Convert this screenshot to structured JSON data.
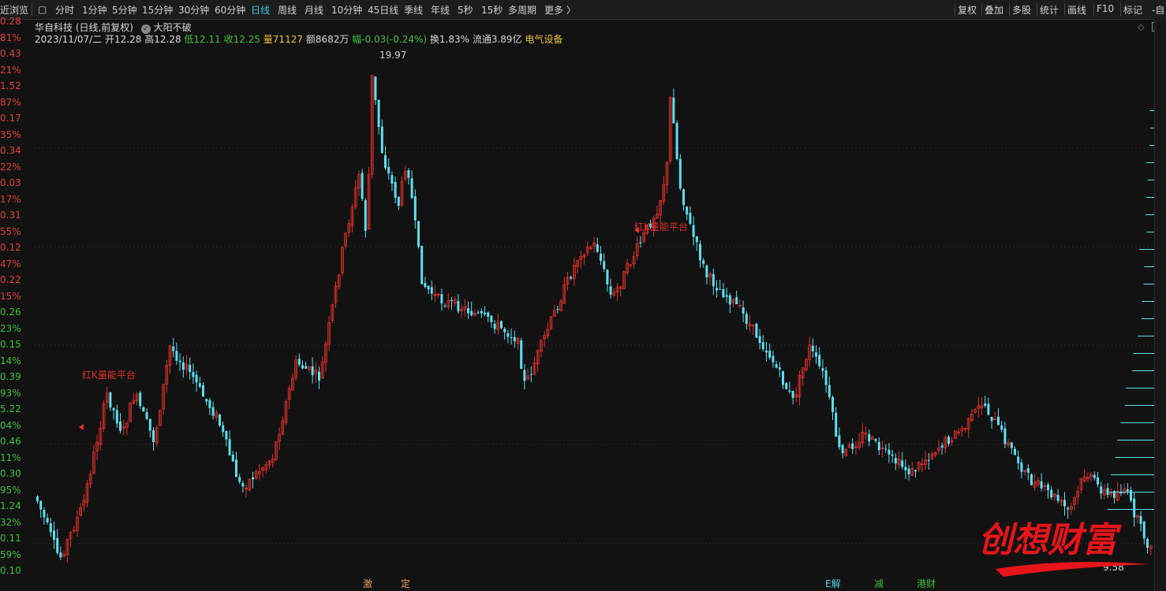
{
  "toolbar": {
    "left_label": "近浏览",
    "periods": [
      "分时",
      "1分钟",
      "5分钟",
      "15分钟",
      "30分钟",
      "60分钟",
      "日线",
      "周线",
      "月线",
      "10分钟",
      "45日线",
      "季线",
      "年线",
      "5秒",
      "15秒",
      "多周期",
      "更多 〉"
    ],
    "active_period": "日线",
    "right_tools": [
      "复权",
      "叠加",
      "多股",
      "统计",
      "画线",
      "F10",
      "标记",
      "-自"
    ]
  },
  "stock": {
    "name": "华自科技 (日线,前复权)",
    "indicator": "大阳不破",
    "date": "2023/11/07/二",
    "open": "开12.28",
    "high": "高12.28",
    "low": "低12.11",
    "close": "收12.25",
    "volume": "量71127",
    "amount": "额8682万",
    "change": "幅-0.03(-0.24%)",
    "turnover": "换1.83%",
    "float_cap": "流通3.89亿",
    "sector": "电气设备"
  },
  "axis_labels": [
    {
      "t": "0.28",
      "c": "#e04040"
    },
    {
      "t": "81%",
      "c": "#e04040"
    },
    {
      "t": "0.43",
      "c": "#e04040"
    },
    {
      "t": "21%",
      "c": "#e04040"
    },
    {
      "t": "1.52",
      "c": "#e04040"
    },
    {
      "t": "87%",
      "c": "#e04040"
    },
    {
      "t": "0.17",
      "c": "#e04040"
    },
    {
      "t": "35%",
      "c": "#e04040"
    },
    {
      "t": "0.34",
      "c": "#e04040"
    },
    {
      "t": "22%",
      "c": "#e04040"
    },
    {
      "t": "0.03",
      "c": "#e04040"
    },
    {
      "t": "17%",
      "c": "#e04040"
    },
    {
      "t": "0.31",
      "c": "#e04040"
    },
    {
      "t": "55%",
      "c": "#e04040"
    },
    {
      "t": "0.12",
      "c": "#e04040"
    },
    {
      "t": "47%",
      "c": "#e04040"
    },
    {
      "t": "0.22",
      "c": "#e04040"
    },
    {
      "t": "15%",
      "c": "#e04040"
    },
    {
      "t": "0.26",
      "c": "#40c040"
    },
    {
      "t": "23%",
      "c": "#40c040"
    },
    {
      "t": "0.15",
      "c": "#40c040"
    },
    {
      "t": "14%",
      "c": "#40c040"
    },
    {
      "t": "0.39",
      "c": "#40c040"
    },
    {
      "t": "93%",
      "c": "#40c040"
    },
    {
      "t": "5.22",
      "c": "#40c040"
    },
    {
      "t": "04%",
      "c": "#40c040"
    },
    {
      "t": "0.46",
      "c": "#40c040"
    },
    {
      "t": "11%",
      "c": "#40c040"
    },
    {
      "t": "0.30",
      "c": "#40c040"
    },
    {
      "t": "95%",
      "c": "#40c040"
    },
    {
      "t": "1.24",
      "c": "#40c040"
    },
    {
      "t": "32%",
      "c": "#40c040"
    },
    {
      "t": "0.11",
      "c": "#40c040"
    },
    {
      "t": "59%",
      "c": "#40c040"
    },
    {
      "t": "0.10",
      "c": "#40c040"
    }
  ],
  "annotations": {
    "peak_label": "19.97",
    "platform_label_1": "红K量能平台",
    "platform_label_2": "红K量能平台",
    "low_label": "9.58"
  },
  "bottom_tags": [
    {
      "t": "激",
      "c": "#e8a060"
    },
    {
      "t": "定",
      "c": "#e8a060"
    },
    {
      "t": "E解",
      "c": "#5ec8e0"
    },
    {
      "t": "减",
      "c": "#40c040"
    },
    {
      "t": "港财",
      "c": "#40c040"
    }
  ],
  "watermark": "创想财富",
  "colors": {
    "up": "#e0302c",
    "down": "#5ee0f0",
    "accent": "#3ec6e0"
  }
}
